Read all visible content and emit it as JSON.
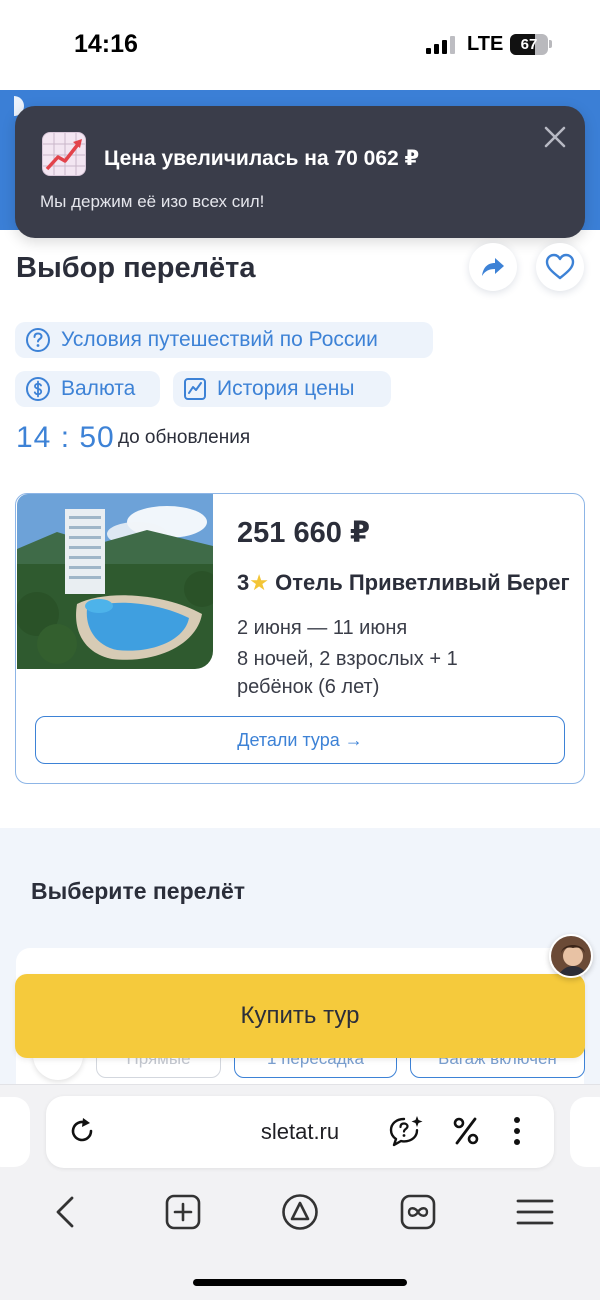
{
  "status_bar": {
    "time": "14:16",
    "network": "LTE",
    "battery_percent": "67",
    "battery_level": 0.67,
    "signal_bars": 3
  },
  "toast": {
    "title": "Цена увеличилась на 70 062 ₽",
    "text": "Мы держим её изо всех сил!",
    "icon": "price-up-chart-icon",
    "close_icon": "close-icon"
  },
  "header": {
    "title": "Выбор перелёта",
    "share_icon": "share-icon",
    "favorite_icon": "heart-icon"
  },
  "chips": {
    "travel_conditions": "Условия путешествий по России",
    "currency": "Валюта",
    "price_history": "История цены"
  },
  "timer": {
    "value": "14 : 50",
    "label": "до обновления"
  },
  "tour": {
    "price": "251 660 ₽",
    "stars": "3",
    "star_symbol": "★",
    "hotel": "Отель  Приветливый Берег",
    "dates": "2 июня — 11 июня",
    "guests": "8 ночей, 2 взрослых + 1 ребёнок (6 лет)",
    "details_button": "Детали тура →"
  },
  "flights": {
    "title": "Выберите перелёт",
    "filters": [
      "Прямые",
      "1 пересадка",
      "Багаж включён"
    ]
  },
  "buy_button": "Купить тур",
  "browser": {
    "url": "sletat.ru",
    "toolbar_icons": [
      "back-icon",
      "new-tab-icon",
      "alice-icon",
      "tabs-icon",
      "menu-icon"
    ],
    "url_bar_icons": [
      "reload-icon",
      "ai-assistant-icon",
      "discount-icon",
      "more-icon"
    ]
  },
  "colors": {
    "accent_blue": "#3d82d6",
    "toast_bg": "#3a3d4a",
    "buy_yellow": "#f5ca3c",
    "header_blue": "#3b7fd6"
  }
}
